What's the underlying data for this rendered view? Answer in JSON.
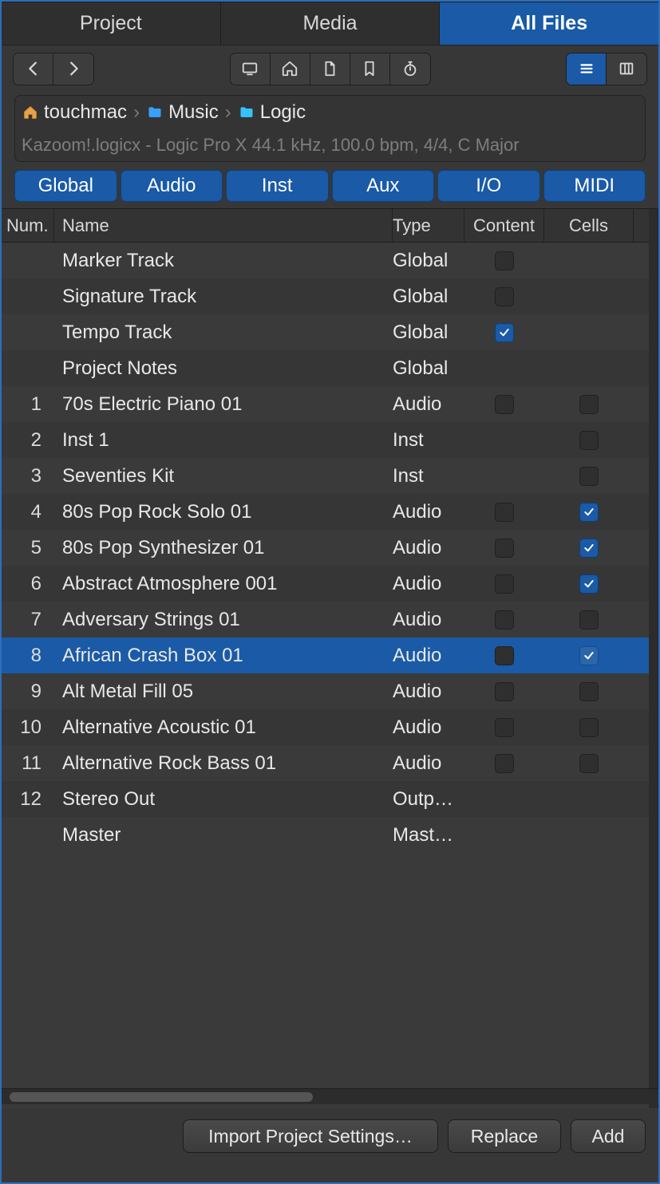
{
  "mainTabs": [
    {
      "label": "Project",
      "active": false
    },
    {
      "label": "Media",
      "active": false
    },
    {
      "label": "All Files",
      "active": true
    }
  ],
  "breadcrumb": {
    "items": [
      {
        "label": "touchmac",
        "iconColor": "house"
      },
      {
        "label": "Music",
        "iconColor": "folder-blue"
      },
      {
        "label": "Logic",
        "iconColor": "folder-cyan"
      }
    ],
    "infoLine": "Kazoom!.logicx - Logic Pro X 44.1 kHz, 100.0 bpm, 4/4, C Major"
  },
  "filters": [
    {
      "label": "Global"
    },
    {
      "label": "Audio"
    },
    {
      "label": "Inst"
    },
    {
      "label": "Aux"
    },
    {
      "label": "I/O"
    },
    {
      "label": "MIDI"
    }
  ],
  "columns": {
    "num": "Num.",
    "name": "Name",
    "type": "Type",
    "content": "Content",
    "cells": "Cells"
  },
  "rows": [
    {
      "num": "",
      "name": "Marker Track",
      "type": "Global",
      "content": "unchecked",
      "cells": null,
      "selected": false
    },
    {
      "num": "",
      "name": "Signature Track",
      "type": "Global",
      "content": "unchecked",
      "cells": null,
      "selected": false
    },
    {
      "num": "",
      "name": "Tempo Track",
      "type": "Global",
      "content": "checked",
      "cells": null,
      "selected": false
    },
    {
      "num": "",
      "name": "Project Notes",
      "type": "Global",
      "content": null,
      "cells": null,
      "selected": false
    },
    {
      "num": "1",
      "name": "70s Electric Piano 01",
      "type": "Audio",
      "content": "unchecked",
      "cells": "unchecked",
      "selected": false
    },
    {
      "num": "2",
      "name": "Inst 1",
      "type": "Inst",
      "content": null,
      "cells": "unchecked",
      "selected": false
    },
    {
      "num": "3",
      "name": "Seventies Kit",
      "type": "Inst",
      "content": null,
      "cells": "unchecked",
      "selected": false
    },
    {
      "num": "4",
      "name": "80s Pop Rock Solo 01",
      "type": "Audio",
      "content": "unchecked",
      "cells": "checked",
      "selected": false
    },
    {
      "num": "5",
      "name": "80s Pop Synthesizer 01",
      "type": "Audio",
      "content": "unchecked",
      "cells": "checked",
      "selected": false
    },
    {
      "num": "6",
      "name": "Abstract Atmosphere 001",
      "type": "Audio",
      "content": "unchecked",
      "cells": "checked",
      "selected": false
    },
    {
      "num": "7",
      "name": "Adversary Strings 01",
      "type": "Audio",
      "content": "unchecked",
      "cells": "unchecked",
      "selected": false
    },
    {
      "num": "8",
      "name": "African Crash Box 01",
      "type": "Audio",
      "content": "unchecked",
      "cells": "checked",
      "selected": true
    },
    {
      "num": "9",
      "name": "Alt Metal Fill 05",
      "type": "Audio",
      "content": "unchecked",
      "cells": "unchecked",
      "selected": false
    },
    {
      "num": "10",
      "name": "Alternative Acoustic 01",
      "type": "Audio",
      "content": "unchecked",
      "cells": "unchecked",
      "selected": false
    },
    {
      "num": "11",
      "name": "Alternative Rock Bass 01",
      "type": "Audio",
      "content": "unchecked",
      "cells": "unchecked",
      "selected": false
    },
    {
      "num": "12",
      "name": "Stereo Out",
      "type": "Outp…",
      "content": null,
      "cells": null,
      "selected": false
    },
    {
      "num": "",
      "name": "Master",
      "type": "Mast…",
      "content": null,
      "cells": null,
      "selected": false
    }
  ],
  "footer": {
    "importSettings": "Import Project Settings…",
    "replace": "Replace",
    "add": "Add"
  }
}
